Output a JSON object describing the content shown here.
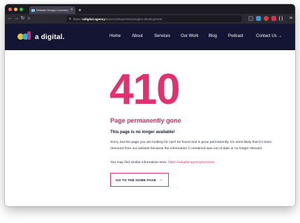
{
  "browser": {
    "tab_title": "Website Design Cumbria | Digi",
    "tab_close": "✕",
    "new_tab": "+",
    "url_domain": "adigital.agency",
    "url_prefix": "https://",
    "url_path": "/services/expressionengine-development",
    "back": "←",
    "forward": "→",
    "reload": "↻",
    "home": "⌂",
    "menu": "≡"
  },
  "site": {
    "logo_text": "a digital.",
    "nav": [
      "Home",
      "About",
      "Services",
      "Our Work",
      "Blog",
      "Podcast",
      "Contact Us →"
    ]
  },
  "error": {
    "code": "410",
    "headline": "Page permanently gone",
    "subhead": "This page is no longer available!",
    "body": "Sorry, but the page you are looking for can't be found and is gone permanently. It's most likely that it's been removed from our website because the information it contained was out of date or no longer relevant.",
    "similar_prefix": "You may find similar information here: ",
    "similar_link": "https://adigital.agency/services",
    "cta_label": "GO TO THE HOME PAGE",
    "cta_arrow": "→"
  },
  "colors": {
    "brand_pink": "#e2316f",
    "nav_bg": "#141533"
  }
}
